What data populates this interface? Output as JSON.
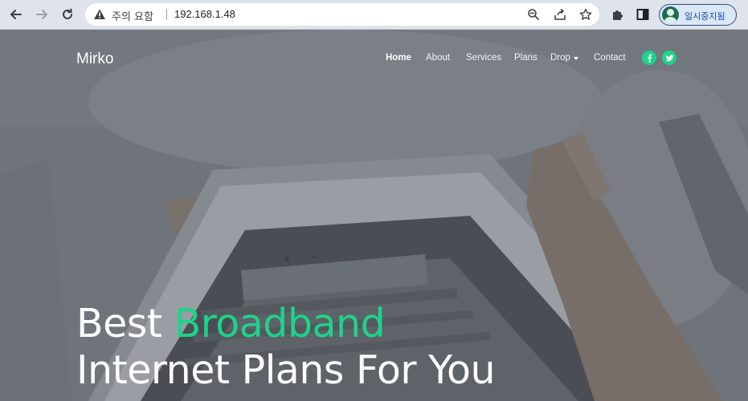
{
  "browser": {
    "security_warning": "주의 요함",
    "url": "192.168.1.48",
    "profile_label": "일시중지됨"
  },
  "site": {
    "brand": "Mirko",
    "nav": [
      {
        "label": "Home",
        "active": true
      },
      {
        "label": "About"
      },
      {
        "label": "Services"
      },
      {
        "label": "Plans"
      },
      {
        "label": "Drop"
      },
      {
        "label": "Contact"
      }
    ],
    "hero": {
      "line1_part1": "Best",
      "line1_accent": "Broadband",
      "line2": "Internet Plans For You"
    }
  },
  "colors": {
    "accent": "#1ed38a",
    "hero_overlay": "#7b8088"
  },
  "icons": {
    "back": "arrow-left-icon",
    "forward": "arrow-right-icon",
    "reload": "reload-icon",
    "warning": "warning-triangle-icon",
    "zoom": "zoom-icon",
    "share": "share-icon",
    "bookmark": "star-icon",
    "extensions": "puzzle-icon",
    "sidepanel": "side-panel-icon",
    "facebook": "facebook-icon",
    "twitter": "twitter-icon"
  }
}
